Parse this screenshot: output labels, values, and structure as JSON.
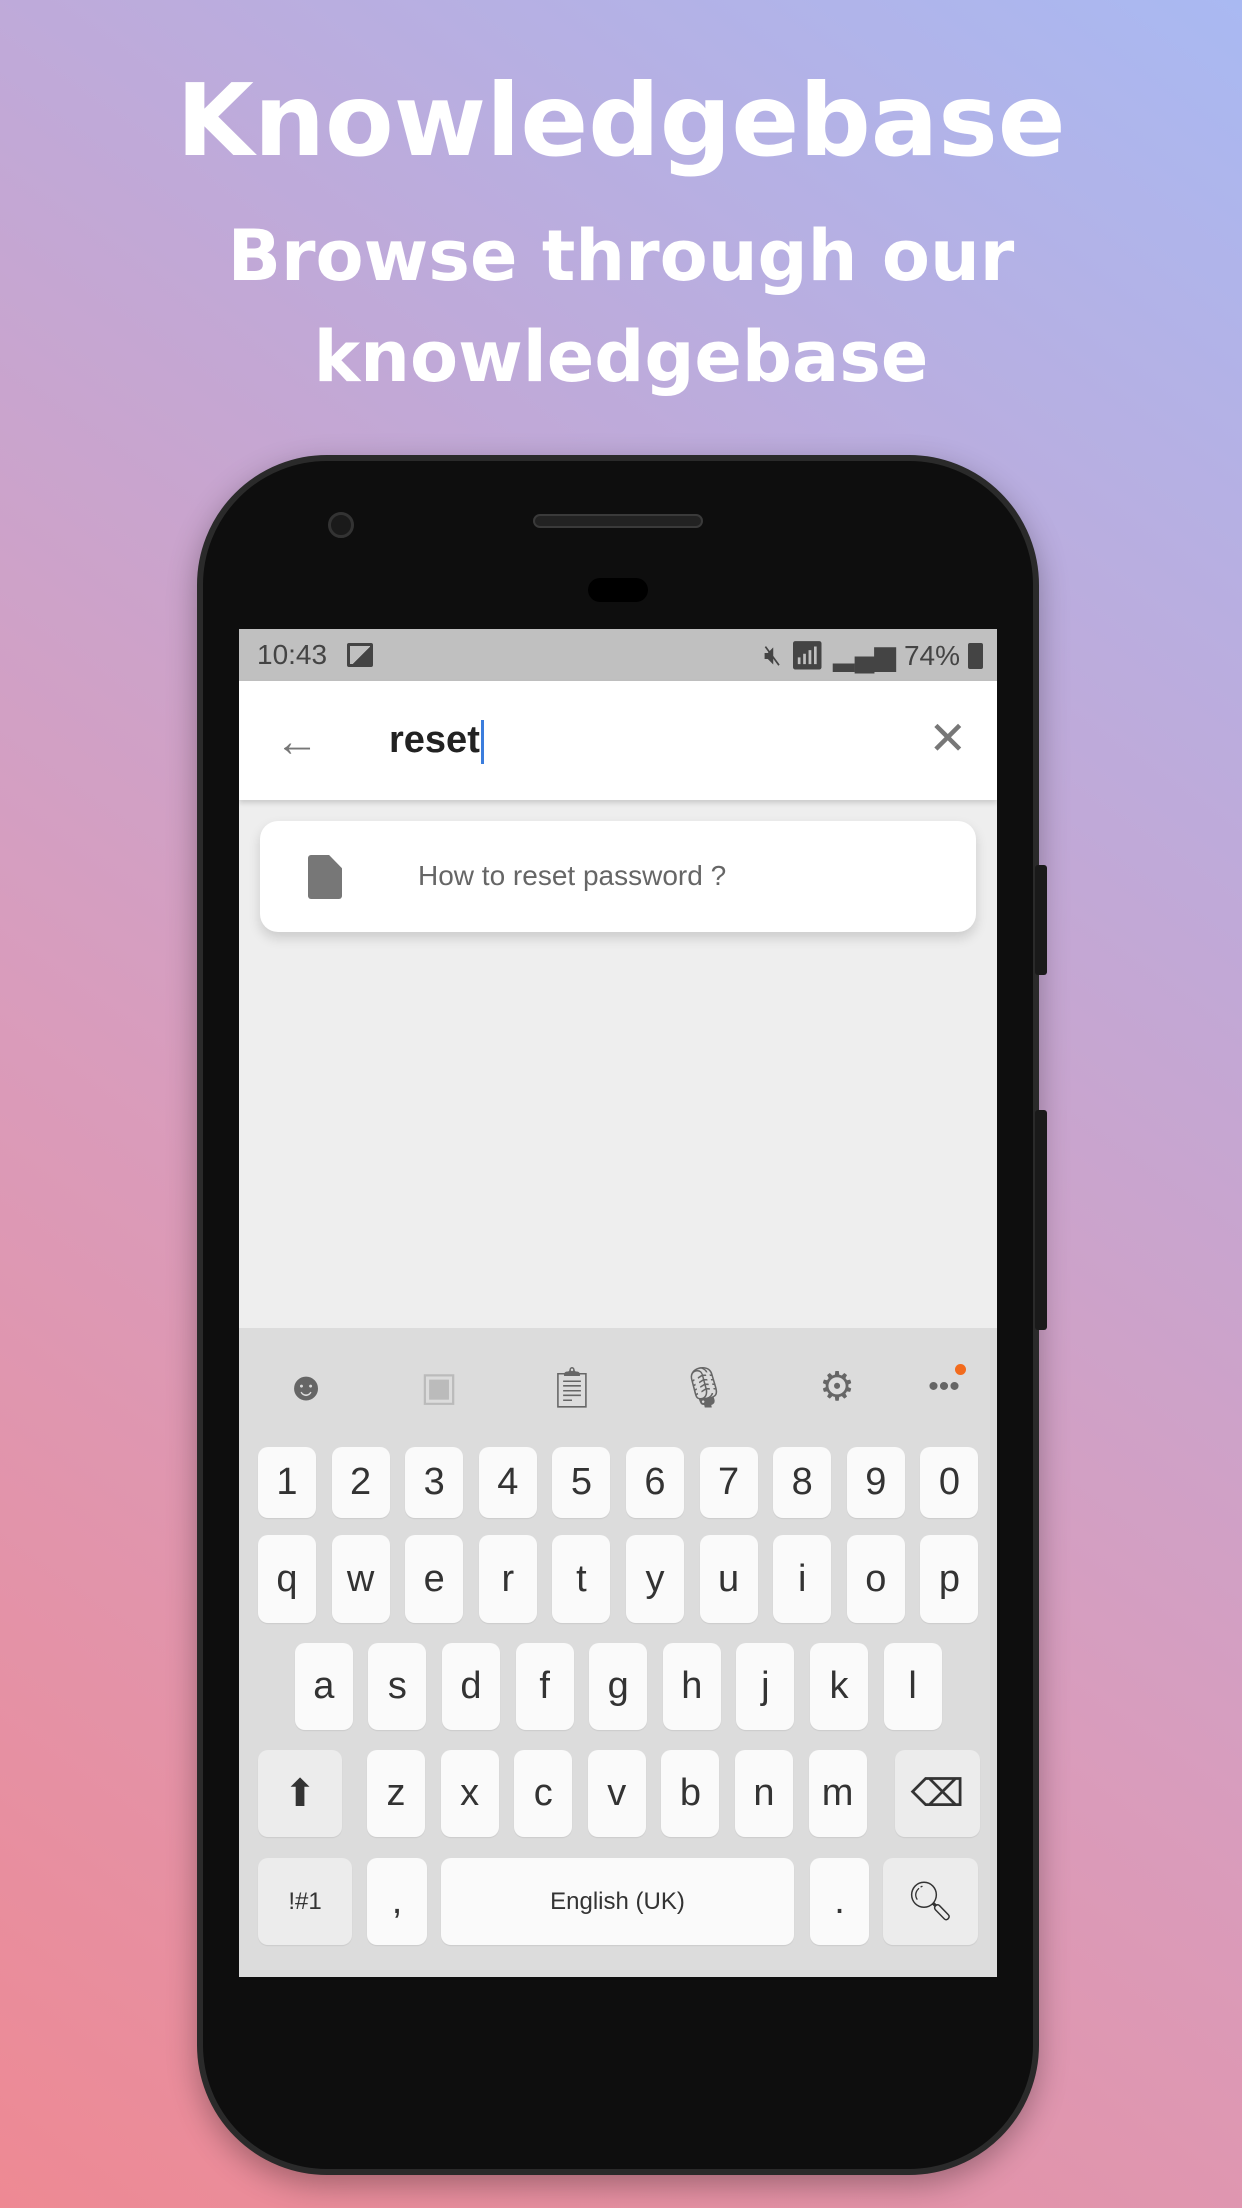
{
  "promo": {
    "title": "Knowledgebase",
    "subtitle_line1": "Browse through our",
    "subtitle_line2": "knowledgebase"
  },
  "status_bar": {
    "time": "10:43",
    "battery": "74%",
    "icons": [
      "image-icon",
      "mute-icon",
      "wifi-icon",
      "signal-icon",
      "battery-icon"
    ]
  },
  "search": {
    "query": "reset",
    "back_icon": "arrow-left-icon",
    "clear_icon": "close-icon"
  },
  "results": [
    {
      "title": "How to reset password ?",
      "icon": "document-icon"
    }
  ],
  "keyboard": {
    "toolbar": [
      "emoji-icon",
      "sticker-icon",
      "clipboard-icon",
      "microphone-icon",
      "settings-icon",
      "more-icon"
    ],
    "notification_dot_color": "#f26b1d",
    "rows": [
      [
        "1",
        "2",
        "3",
        "4",
        "5",
        "6",
        "7",
        "8",
        "9",
        "0"
      ],
      [
        "q",
        "w",
        "e",
        "r",
        "t",
        "y",
        "u",
        "i",
        "o",
        "p"
      ],
      [
        "a",
        "s",
        "d",
        "f",
        "g",
        "h",
        "j",
        "k",
        "l"
      ],
      [
        "z",
        "x",
        "c",
        "v",
        "b",
        "n",
        "m"
      ]
    ],
    "symbols_label": "!#1",
    "comma": ",",
    "space_label": "English (UK)",
    "period": "."
  }
}
